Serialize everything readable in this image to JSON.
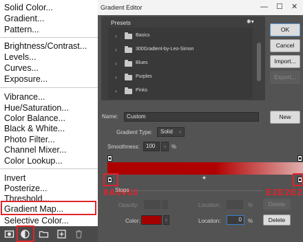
{
  "menu": {
    "items": [
      {
        "label": "Solid Color...",
        "group": 1
      },
      {
        "label": "Gradient...",
        "group": 1
      },
      {
        "label": "Pattern...",
        "group": 1
      },
      {
        "label": "Brightness/Contrast...",
        "group": 2
      },
      {
        "label": "Levels...",
        "group": 2
      },
      {
        "label": "Curves...",
        "group": 2
      },
      {
        "label": "Exposure...",
        "group": 2
      },
      {
        "label": "Vibrance...",
        "group": 3
      },
      {
        "label": "Hue/Saturation...",
        "group": 3
      },
      {
        "label": "Color Balance...",
        "group": 3
      },
      {
        "label": "Black & White...",
        "group": 3
      },
      {
        "label": "Photo Filter...",
        "group": 3
      },
      {
        "label": "Channel Mixer...",
        "group": 3
      },
      {
        "label": "Color Lookup...",
        "group": 3
      },
      {
        "label": "Invert",
        "group": 4
      },
      {
        "label": "Posterize...",
        "group": 4
      },
      {
        "label": "Threshold...",
        "group": 4
      },
      {
        "label": "Gradient Map...",
        "group": 4,
        "highlighted": true
      },
      {
        "label": "Selective Color...",
        "group": 4
      }
    ],
    "toolbar_icons": [
      "mask-icon",
      "adjustment-layer-icon",
      "folder-icon",
      "new-layer-icon",
      "trash-icon"
    ],
    "highlight_color": "#e0242b"
  },
  "dialog": {
    "title": "Gradient Editor",
    "window_controls": [
      "—",
      "☐",
      "✕"
    ],
    "presets": {
      "label": "Presets",
      "gear": "✱▾",
      "folders": [
        "Basics",
        "300Gradient-by-Leo-Simon",
        "Blues",
        "Purples",
        "Pinks"
      ]
    },
    "buttons": {
      "ok": "OK",
      "cancel": "Cancel",
      "import": "Import...",
      "export": "Export...",
      "new": "New",
      "delete": "Delete"
    },
    "name": {
      "label": "Name:",
      "value": "Custom"
    },
    "gradient_type": {
      "label": "Gradient Type:",
      "value": "Solid"
    },
    "smoothness": {
      "label": "Smoothness:",
      "value": "100",
      "unit": "%"
    },
    "stops": {
      "label": "Stops",
      "opacity_label": "Opacity:",
      "location_label": "Location:",
      "location_unit": "%",
      "color_label": "Color:",
      "color_location_value": "0",
      "color_swatch": "#a50000"
    },
    "overlay_codes": {
      "left": "8A0000",
      "right": "E2E2E2"
    }
  }
}
